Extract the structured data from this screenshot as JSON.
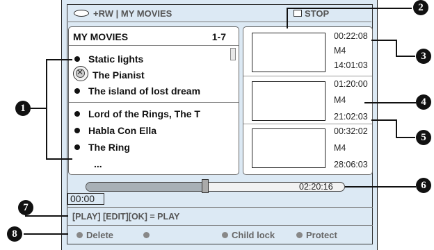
{
  "header": {
    "title": "+RW | MY MOVIES",
    "stop_label": "STOP"
  },
  "list": {
    "title": "MY MOVIES",
    "range": "1-7",
    "group1": [
      "Static lights",
      "The Pianist",
      "The island of lost dream"
    ],
    "group2": [
      "Lord of the Rings, The T",
      "Habla Con Ella",
      "The Ring"
    ],
    "more": "..."
  },
  "thumbs": [
    {
      "info": [
        "00:22:08",
        "M4",
        "14:01:03"
      ]
    },
    {
      "info": [
        "01:20:00",
        "M4",
        "21:02:03"
      ]
    },
    {
      "info": [
        "00:32:02",
        "M4",
        "28:06:03"
      ]
    }
  ],
  "progress": {
    "total": "02:20:16",
    "elapsed": "00:00",
    "position_fraction": 0.46
  },
  "command_hint": "[PLAY] [EDIT][OK] = PLAY",
  "color_keys": {
    "delete": "Delete",
    "child_lock": "Child lock",
    "protect": "Protect"
  },
  "callouts": [
    "1",
    "2",
    "3",
    "4",
    "5",
    "6",
    "7",
    "8"
  ]
}
